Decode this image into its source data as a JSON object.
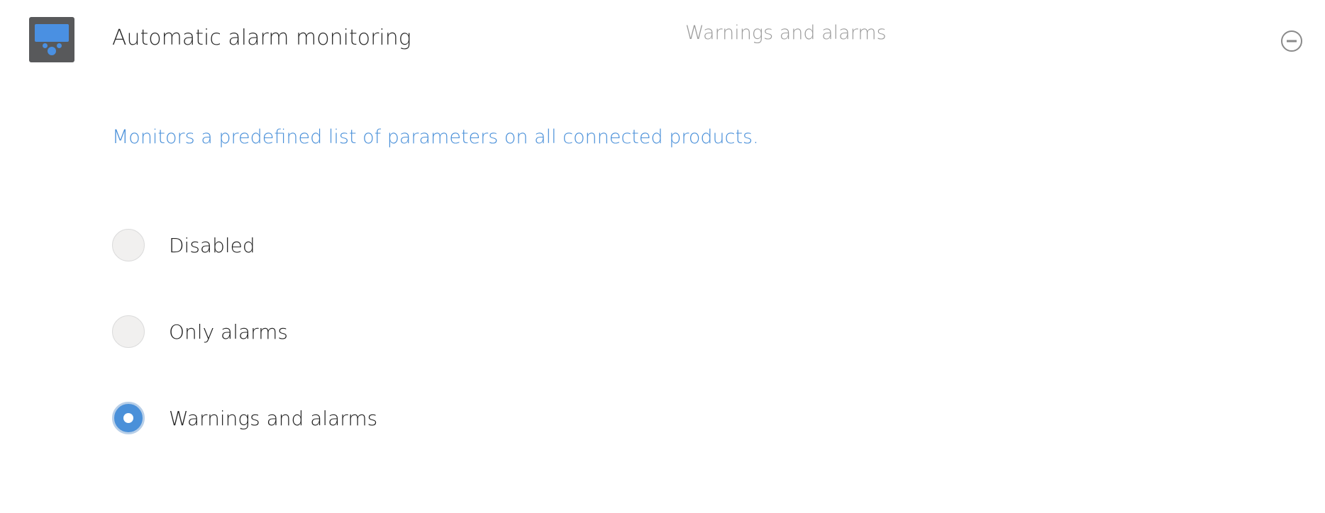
{
  "header": {
    "icon": "device-display-icon",
    "title": "Automatic alarm monitoring",
    "current_value": "Warnings and alarms",
    "collapse_icon": "minus-circle-icon"
  },
  "description": "Monitors a predefined list of parameters on all connected products.",
  "options": [
    {
      "label": "Disabled",
      "selected": false
    },
    {
      "label": "Only alarms",
      "selected": false
    },
    {
      "label": "Warnings and alarms",
      "selected": true
    }
  ],
  "colors": {
    "accent": "#4a90d9",
    "muted_text": "#9b9b9b",
    "icon_body": "#58595b"
  }
}
